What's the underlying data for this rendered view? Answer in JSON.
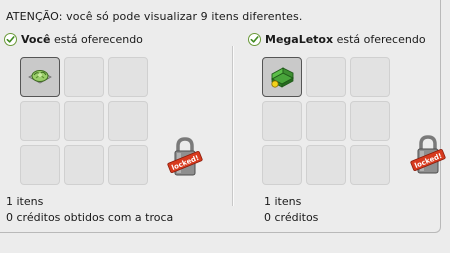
{
  "warning": "ATENÇÃO: você só pode visualizar 9 itens diferentes.",
  "colors": {
    "check": "#3f8a1f",
    "lock_badge": "#d73a1e",
    "slot": "#e2e2e2",
    "slot_filled": "#c9c9c9"
  },
  "left": {
    "owner": "Você",
    "suffix": " está oferecendo",
    "item_icons": [
      "cabbage-plant-icon"
    ],
    "lock_icon": "locked-padlock-icon",
    "lock_text": "locked!",
    "count": "1 itens",
    "credits": "0 créditos obtidos com a troca"
  },
  "right": {
    "owner": "MegaLetox",
    "suffix": " está oferecendo",
    "item_icons": [
      "green-sofa-icon"
    ],
    "lock_icon": "locked-padlock-icon",
    "lock_text": "locked!",
    "count": "1 itens",
    "credits": "0 créditos"
  }
}
